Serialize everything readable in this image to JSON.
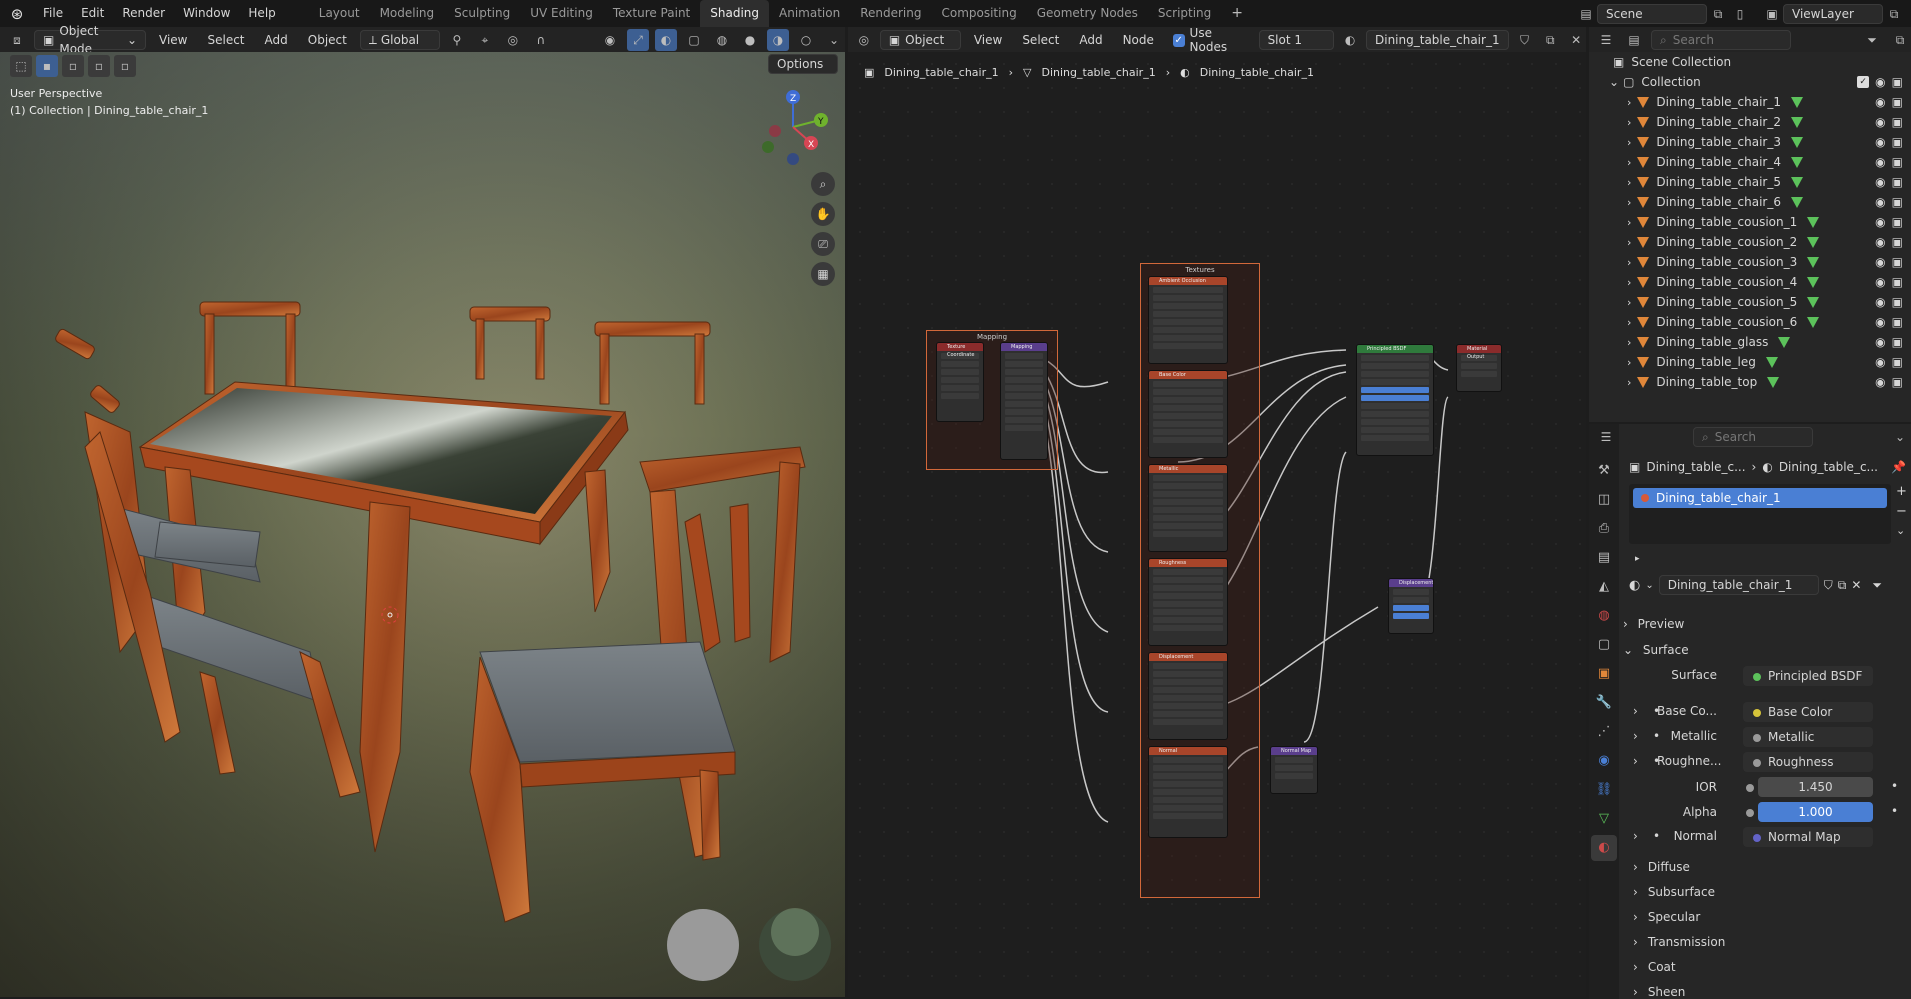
{
  "menubar": {
    "items": [
      "File",
      "Edit",
      "Render",
      "Window",
      "Help"
    ],
    "workspaces": [
      "Layout",
      "Modeling",
      "Sculpting",
      "UV Editing",
      "Texture Paint",
      "Shading",
      "Animation",
      "Rendering",
      "Compositing",
      "Geometry Nodes",
      "Scripting"
    ],
    "active_workspace": "Shading",
    "add_tab": "+",
    "scene": "Scene",
    "view_layer": "ViewLayer"
  },
  "viewport_header": {
    "mode": "Object Mode",
    "menus": [
      "View",
      "Select",
      "Add",
      "Object"
    ],
    "orientation": "Global",
    "options": "Options"
  },
  "viewport": {
    "perspective": "User Perspective",
    "collection_info": "(1) Collection | Dining_table_chair_1",
    "gizmo": {
      "z": "Z",
      "y": "Y",
      "x": "X"
    }
  },
  "node_header": {
    "type": "Object",
    "menus": [
      "View",
      "Select",
      "Add",
      "Node"
    ],
    "use_nodes_label": "Use Nodes",
    "use_nodes_checked": true,
    "slot": "Slot 1",
    "material": "Dining_table_chair_1"
  },
  "node_breadcrumb": [
    "Dining_table_chair_1",
    "Dining_table_chair_1",
    "Dining_table_chair_1"
  ],
  "node_editor": {
    "frames": {
      "mapping": "Mapping",
      "textures": "Textures"
    },
    "nodes": {
      "texcoord": "Texture Coordinate",
      "mapping": "Mapping",
      "ao": "Ambient Occlusion",
      "base_color": "Base Color",
      "metallic": "Metallic",
      "roughness": "Roughness",
      "displacement_tex": "Displacement",
      "normal_tex": "Normal",
      "bsdf": "Principled BSDF",
      "output": "Material Output",
      "displacement": "Displacement",
      "normal_map": "Normal Map"
    }
  },
  "outliner": {
    "search_placeholder": "Search",
    "scene_collection": "Scene Collection",
    "collection": "Collection",
    "items": [
      "Dining_table_chair_1",
      "Dining_table_chair_2",
      "Dining_table_chair_3",
      "Dining_table_chair_4",
      "Dining_table_chair_5",
      "Dining_table_chair_6",
      "Dining_table_cousion_1",
      "Dining_table_cousion_2",
      "Dining_table_cousion_3",
      "Dining_table_cousion_4",
      "Dining_table_cousion_5",
      "Dining_table_cousion_6",
      "Dining_table_glass",
      "Dining_table_leg",
      "Dining_table_top"
    ]
  },
  "properties": {
    "search_placeholder": "Search",
    "breadcrumb": [
      "Dining_table_c...",
      "Dining_table_c..."
    ],
    "material_slot": "Dining_table_chair_1",
    "material_name": "Dining_table_chair_1",
    "sections": {
      "preview": "Preview",
      "surface": "Surface"
    },
    "surface_label": "Surface",
    "surface_value": "Principled BSDF",
    "inputs": [
      {
        "label": "Base Co...",
        "value": "Base Color",
        "color": "#d6c43a"
      },
      {
        "label": "Metallic",
        "value": "Metallic",
        "color": "#9a9a9a"
      },
      {
        "label": "Roughne...",
        "value": "Roughness",
        "color": "#9a9a9a"
      }
    ],
    "ior_label": "IOR",
    "ior_value": "1.450",
    "alpha_label": "Alpha",
    "alpha_value": "1.000",
    "normal_label": "Normal",
    "normal_value": "Normal Map",
    "subpanels": [
      "Diffuse",
      "Subsurface",
      "Specular",
      "Transmission",
      "Coat",
      "Sheen"
    ]
  },
  "colors": {
    "accent": "#4a7fd4",
    "frame": "#d2683a",
    "wood": "#b2552a"
  }
}
